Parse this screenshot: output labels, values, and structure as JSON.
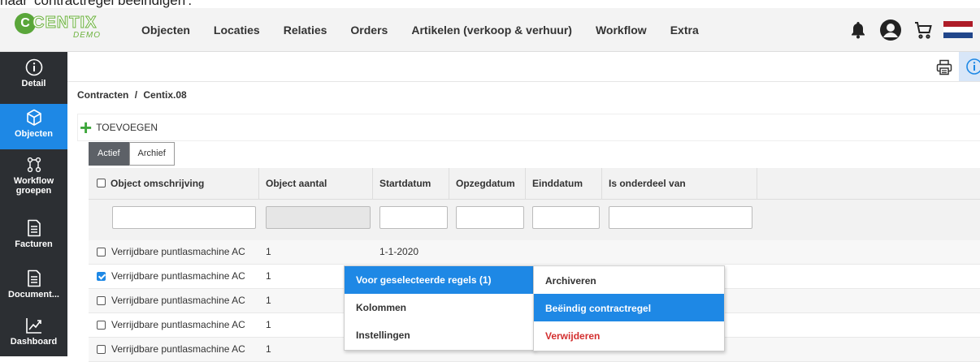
{
  "caption": "naar 'contractregel beëindigen'.",
  "logo": {
    "brand": "CENTIX",
    "sub": "DEMO"
  },
  "nav": [
    "Objecten",
    "Locaties",
    "Relaties",
    "Orders",
    "Artikelen (verkoop & verhuur)",
    "Workflow",
    "Extra"
  ],
  "top_icons": [
    "bell-icon",
    "user-avatar-icon",
    "cart-icon",
    "flag-nl-icon"
  ],
  "flag_colors": [
    "#ae1c28",
    "#ffffff",
    "#21468b"
  ],
  "sidebar": [
    {
      "label": "Detail",
      "icon": "info-icon"
    },
    {
      "label": "Objecten",
      "icon": "cube-icon",
      "active": true
    },
    {
      "label": "Workflow groepen",
      "icon": "workflow-icon"
    },
    {
      "label": "Facturen",
      "icon": "document-icon"
    },
    {
      "label": "Document...",
      "icon": "document-icon"
    },
    {
      "label": "Dashboard",
      "icon": "chart-icon"
    }
  ],
  "breadcrumb": {
    "parent": "Contracten",
    "sep": "/",
    "current": "Centix.08"
  },
  "add_label": "TOEVOEGEN",
  "tabs": [
    "Actief",
    "Archief"
  ],
  "columns": [
    "Object omschrijving",
    "Object aantal",
    "Startdatum",
    "Opzegdatum",
    "Einddatum",
    "Is onderdeel van"
  ],
  "rows": [
    {
      "desc": "Verrijdbare puntlasmachine AC",
      "qty": "1",
      "start": "1-1-2020",
      "checked": false
    },
    {
      "desc": "Verrijdbare puntlasmachine AC",
      "qty": "1",
      "start": "",
      "checked": true
    },
    {
      "desc": "Verrijdbare puntlasmachine AC",
      "qty": "1",
      "start": "",
      "checked": false
    },
    {
      "desc": "Verrijdbare puntlasmachine AC",
      "qty": "1",
      "start": "",
      "checked": false
    },
    {
      "desc": "Verrijdbare puntlasmachine AC",
      "qty": "1",
      "start": "",
      "checked": false
    }
  ],
  "context_menu": [
    "Voor geselecteerde regels (1)",
    "Kolommen",
    "Instellingen"
  ],
  "submenu": [
    "Archiveren",
    "Beëindig contractregel",
    "Verwijderen"
  ],
  "colors": {
    "accent": "#1e88e5",
    "sidebar": "#2c2f33",
    "danger": "#d32f2f",
    "add": "#3da63b"
  }
}
